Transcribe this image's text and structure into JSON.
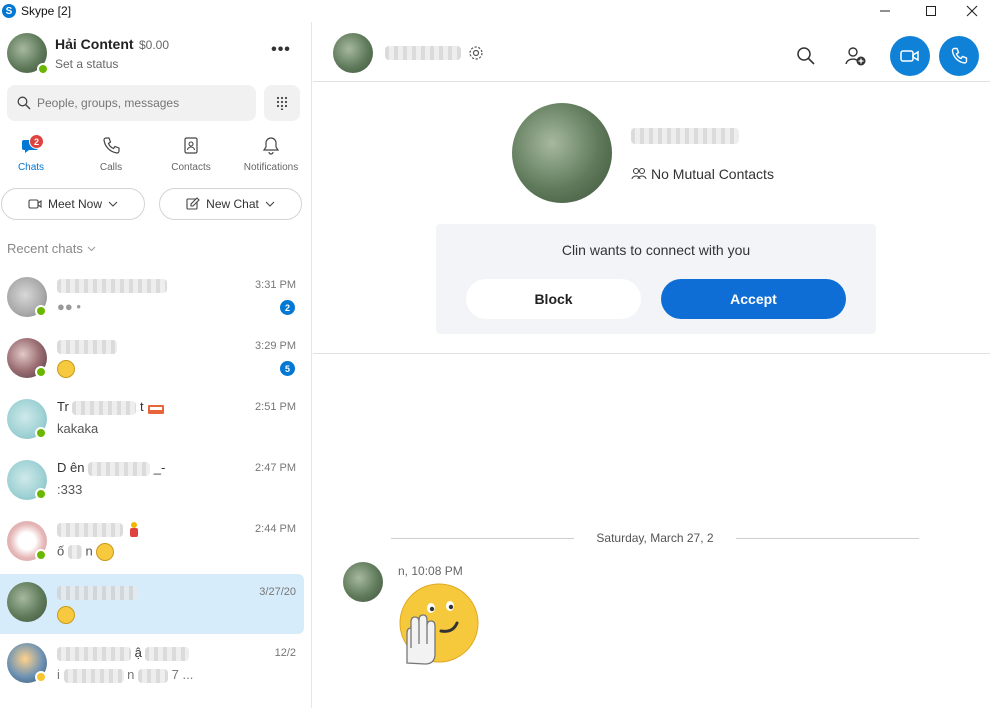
{
  "window": {
    "title": "Skype [2]",
    "logo_letter": "S"
  },
  "profile": {
    "name": "Hải Content",
    "credit": "$0.00",
    "status": "Set a status",
    "more_label": "•••"
  },
  "search": {
    "placeholder": "People, groups, messages"
  },
  "nav": {
    "tabs": [
      {
        "label": "Chats",
        "badge": "2"
      },
      {
        "label": "Calls"
      },
      {
        "label": "Contacts"
      },
      {
        "label": "Notifications"
      }
    ]
  },
  "actions": {
    "meet_now": "Meet Now",
    "new_chat": "New Chat"
  },
  "recent": {
    "header": "Recent chats"
  },
  "chats": [
    {
      "time": "3:31 PM",
      "unread": "2",
      "preview": "●● •"
    },
    {
      "time": "3:29 PM",
      "unread": "5"
    },
    {
      "name_start": "Tr",
      "name_mid": "t",
      "time": "2:51 PM",
      "preview": "kakaka"
    },
    {
      "name_start": "D",
      "name_mid": "ên",
      "name_end": "_-",
      "time": "2:47 PM",
      "preview": ":333"
    },
    {
      "time": "2:44 PM",
      "preview": "ố",
      "preview_mid": "n"
    },
    {
      "time": "3/27/20"
    },
    {
      "name_mid": "ậ",
      "time": "12/2",
      "preview_start": "i",
      "preview_mid": "n",
      "preview_end": "7 ..."
    }
  ],
  "conversation": {
    "no_mutual": "No Mutual Contacts",
    "request_text": "Clin wants to connect with you",
    "block_label": "Block",
    "accept_label": "Accept",
    "date_separator": "Saturday, March 27, 2",
    "message_time": "n, 10:08 PM"
  },
  "colors": {
    "accent": "#0078d4",
    "accept": "#0f6ed6",
    "online": "#6bb700",
    "badge_red": "#e0433f"
  }
}
